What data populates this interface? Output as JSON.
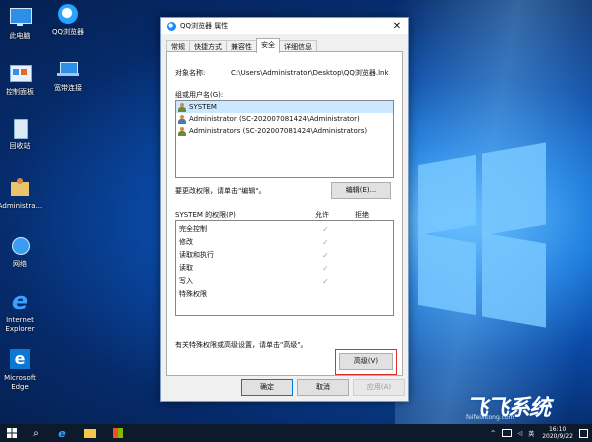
{
  "desktop": {
    "icons": [
      {
        "label": "此电脑"
      },
      {
        "label": "QQ浏览器"
      },
      {
        "label": "控制面板"
      },
      {
        "label": "宽带连接"
      },
      {
        "label": "回收站"
      },
      {
        "label": "Administra..."
      },
      {
        "label": "网络"
      },
      {
        "label": "Internet\nExplorer"
      },
      {
        "label": "Microsoft\nEdge"
      }
    ]
  },
  "dialog": {
    "title": "QQ浏览器 属性",
    "close_glyph": "✕",
    "tabs": [
      "常规",
      "快捷方式",
      "兼容性",
      "安全",
      "详细信息"
    ],
    "active_tab": "安全",
    "object_name_label": "对象名称:",
    "object_name_value": "C:\\Users\\Administrator\\Desktop\\QQ浏览器.lnk",
    "group_label": "组或用户名(G):",
    "users": [
      {
        "name": "SYSTEM",
        "selected": true,
        "icon": "group-icon"
      },
      {
        "name": "Administrator (SC-202007081424\\Administrator)",
        "selected": false,
        "icon": "user-icon"
      },
      {
        "name": "Administrators (SC-202007081424\\Administrators)",
        "selected": false,
        "icon": "group-icon"
      }
    ],
    "change_perm_text": "要更改权限，请单击\"编辑\"。",
    "edit_button": "编辑(E)...",
    "perm_header": "SYSTEM 的权限(P)",
    "allow_col": "允许",
    "deny_col": "拒绝",
    "permissions": [
      {
        "name": "完全控制",
        "allow": "✓"
      },
      {
        "name": "修改",
        "allow": "✓"
      },
      {
        "name": "读取和执行",
        "allow": "✓"
      },
      {
        "name": "读取",
        "allow": "✓"
      },
      {
        "name": "写入",
        "allow": "✓"
      },
      {
        "name": "特殊权限",
        "allow": ""
      }
    ],
    "advanced_text": "有关特殊权限或高级设置，请单击\"高级\"。",
    "advanced_button": "高级(V)",
    "ok_button": "确定",
    "cancel_button": "取消",
    "apply_button": "应用(A)"
  },
  "taskbar": {
    "search_glyph": "⌕",
    "time": "16:10",
    "date": "2020/9/22",
    "ime": "英",
    "tray_chevron": "^"
  },
  "watermark": {
    "brand": "飞飞系统",
    "sub": "feifeixitong.com"
  },
  "colors": {
    "accent": "#0078d7",
    "highlight_box": "#d9302a",
    "selected_row": "#cce8ff"
  }
}
